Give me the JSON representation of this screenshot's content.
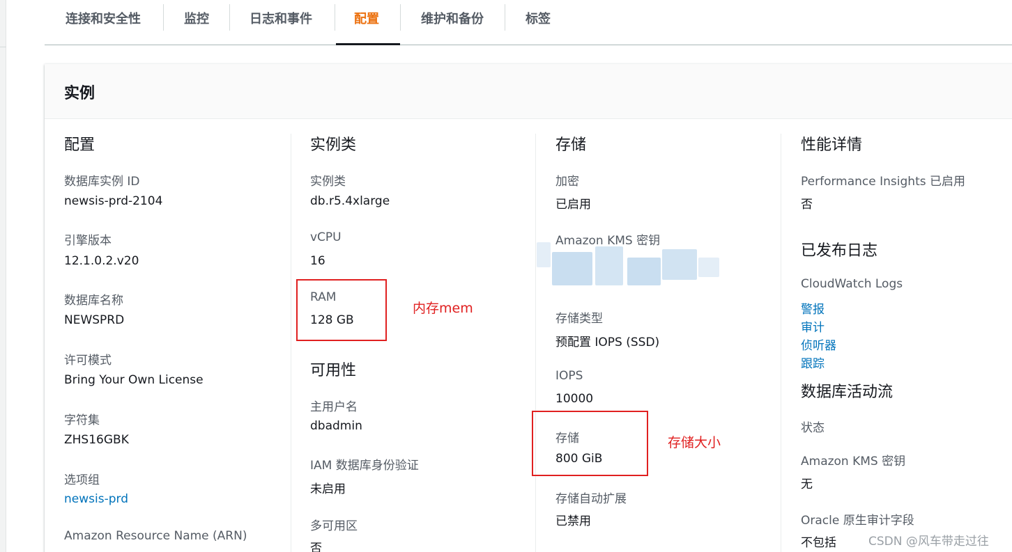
{
  "tabs": [
    {
      "label": "连接和安全性"
    },
    {
      "label": "监控"
    },
    {
      "label": "日志和事件"
    },
    {
      "label": "配置"
    },
    {
      "label": "维护和备份"
    },
    {
      "label": "标签"
    }
  ],
  "active_tab": "配置",
  "panel": {
    "title": "实例"
  },
  "config": {
    "title": "配置",
    "db_instance_id": {
      "label": "数据库实例 ID",
      "value": "newsis-prd-2104"
    },
    "engine_version": {
      "label": "引擎版本",
      "value": "12.1.0.2.v20"
    },
    "db_name": {
      "label": "数据库名称",
      "value": "NEWSPRD"
    },
    "license_model": {
      "label": "许可模式",
      "value": "Bring Your Own License"
    },
    "charset": {
      "label": "字符集",
      "value": "ZHS16GBK"
    },
    "option_group": {
      "label": "选项组",
      "value": "newsis-prd"
    },
    "arn": {
      "label": "Amazon Resource Name (ARN)"
    }
  },
  "instance_class": {
    "title": "实例类",
    "class": {
      "label": "实例类",
      "value": "db.r5.4xlarge"
    },
    "vcpu": {
      "label": "vCPU",
      "value": "16"
    },
    "ram": {
      "label": "RAM",
      "value": "128 GB"
    }
  },
  "availability": {
    "title": "可用性",
    "master_user": {
      "label": "主用户名",
      "value": "dbadmin"
    },
    "iam_auth": {
      "label": "IAM 数据库身份验证",
      "value": "未启用"
    },
    "multi_az": {
      "label": "多可用区",
      "value": "否"
    }
  },
  "storage": {
    "title": "存储",
    "encryption": {
      "label": "加密",
      "value": "已启用"
    },
    "kms_key": {
      "label": "Amazon KMS 密钥"
    },
    "storage_type": {
      "label": "存储类型",
      "value": "预配置 IOPS (SSD)"
    },
    "iops": {
      "label": "IOPS",
      "value": "10000"
    },
    "storage_size": {
      "label": "存储",
      "value": "800 GiB"
    },
    "autoscaling": {
      "label": "存储自动扩展",
      "value": "已禁用"
    }
  },
  "performance": {
    "title": "性能详情",
    "pi": {
      "label": "Performance Insights 已启用",
      "value": "否"
    }
  },
  "published_logs": {
    "title": "已发布日志",
    "cloudwatch": {
      "label": "CloudWatch Logs"
    },
    "links": [
      "警报",
      "审计",
      "侦听器",
      "跟踪"
    ]
  },
  "activity_stream": {
    "title": "数据库活动流",
    "status": {
      "label": "状态"
    },
    "kms_key": {
      "label": "Amazon KMS 密钥",
      "value": "无"
    },
    "oracle_audit": {
      "label": "Oracle 原生审计字段",
      "value": "不包括"
    }
  },
  "annotations": {
    "ram_note": "内存mem",
    "storage_note": "存储大小",
    "color": "#e02020"
  },
  "watermark": "CSDN @风车带走过往",
  "colors": {
    "accent": "#ec7211",
    "link": "#0073bb",
    "text": "#16191f",
    "muted": "#545b64"
  }
}
